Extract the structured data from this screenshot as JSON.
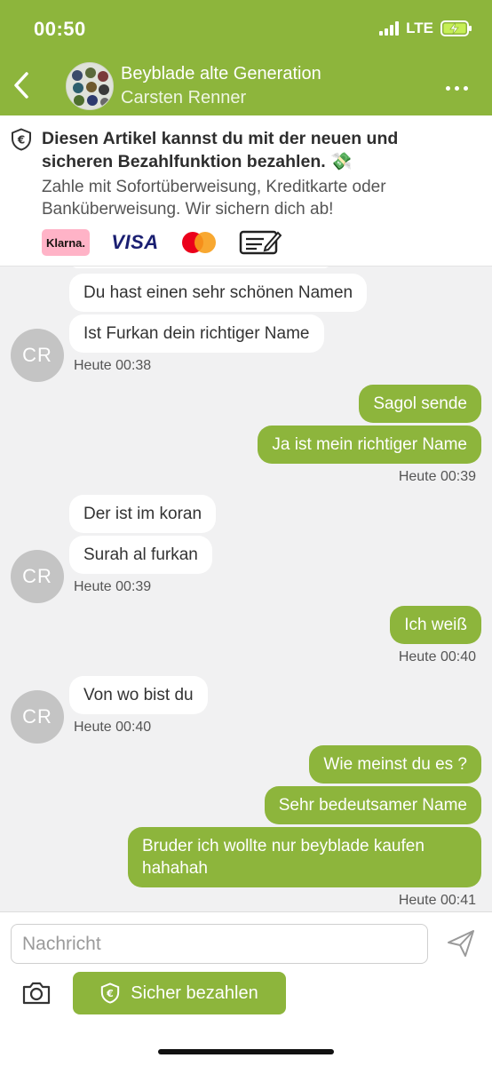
{
  "status": {
    "time": "00:50",
    "network": "LTE"
  },
  "header": {
    "title": "Beyblade alte Generation",
    "subtitle": "Carsten Renner"
  },
  "banner": {
    "title": "Diesen Artikel kannst du mit der neuen und sicheren Bezahlfunktion bezahlen. 💸",
    "description": "Zahle mit Sofortüberweisung, Kreditkarte oder Banküberweisung. Wir sichern dich ab!",
    "payment_methods": {
      "klarna": "Klarna.",
      "visa": "VISA"
    }
  },
  "other_avatar_initials": "CR",
  "messages": [
    {
      "text": "Du hast einen sehr schönen Namen"
    },
    {
      "text": "Ist Furkan dein richtiger Name"
    },
    {
      "time": "Heute 00:38"
    },
    {
      "text": "Sagol sende"
    },
    {
      "text": "Ja ist mein richtiger Name"
    },
    {
      "time": "Heute 00:39"
    },
    {
      "text": "Der ist im koran"
    },
    {
      "text": "Surah al furkan"
    },
    {
      "time": "Heute 00:39"
    },
    {
      "text": "Ich weiß"
    },
    {
      "time": "Heute 00:40"
    },
    {
      "text": "Von wo bist du"
    },
    {
      "time": "Heute 00:40"
    },
    {
      "text": "Wie meinst du es ?"
    },
    {
      "text": "Sehr bedeutsamer Name"
    },
    {
      "text": "Bruder ich wollte nur beyblade kaufen hahahah"
    },
    {
      "time": "Heute 00:41"
    }
  ],
  "composer": {
    "placeholder": "Nachricht",
    "pay_button_label": "Sicher bezahlen"
  },
  "colors": {
    "brand_green": "#8db53c",
    "incoming_bubble": "#ffffff",
    "background": "#f1f1f2"
  }
}
